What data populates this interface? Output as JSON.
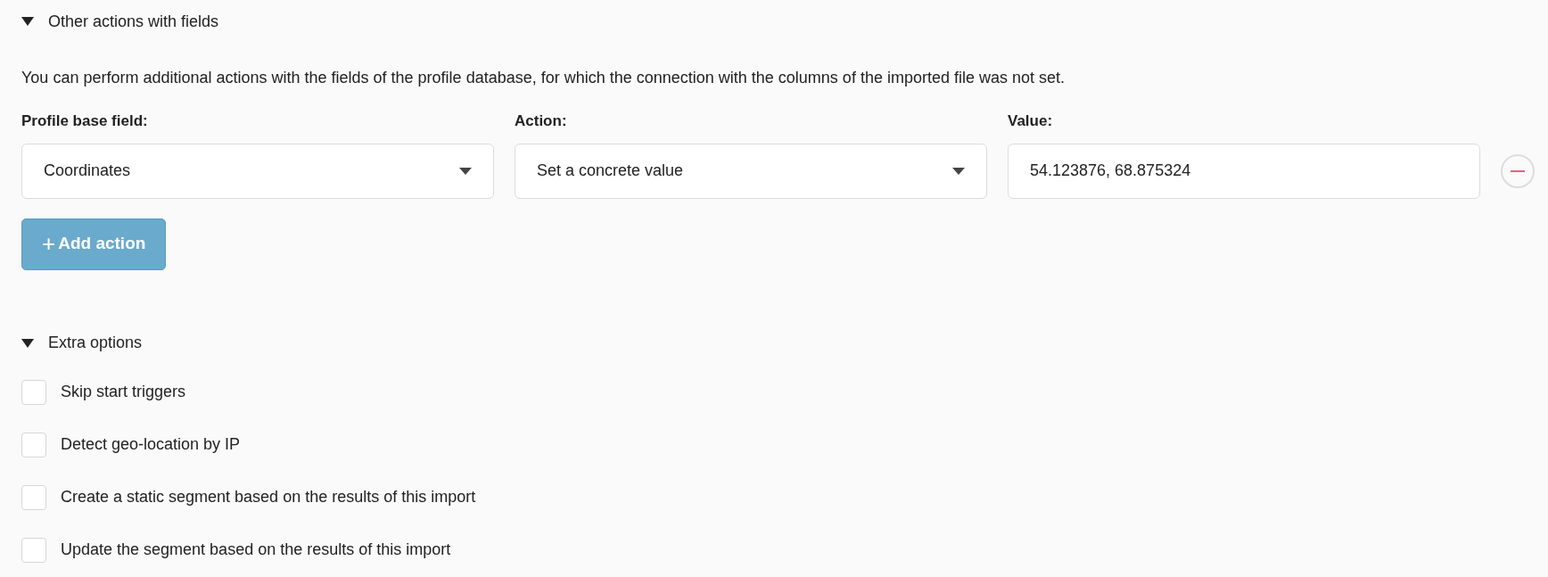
{
  "sections": [
    {
      "kind": "actions",
      "title": "Other actions with fields",
      "expanded": true,
      "description": "You can perform additional actions with the fields of the profile database, for which the connection with the columns of the imported file was not set.",
      "columns": [
        "Profile base field:",
        "Action:",
        "Value:"
      ],
      "rows": [
        {
          "field": "Coordinates",
          "action": "Set a concrete value",
          "value": "54.123876, 68.875324"
        }
      ],
      "add_button": {
        "icon": "+",
        "label": "Add action"
      }
    },
    {
      "kind": "options",
      "title": "Extra options",
      "expanded": true,
      "options": [
        {
          "label": "Skip start triggers",
          "checked": false
        },
        {
          "label": "Detect geo-location by IP",
          "checked": false
        },
        {
          "label": "Create a static segment based on the results of this import",
          "checked": false
        },
        {
          "label": "Update the segment based on the results of this import",
          "checked": false
        }
      ]
    }
  ]
}
